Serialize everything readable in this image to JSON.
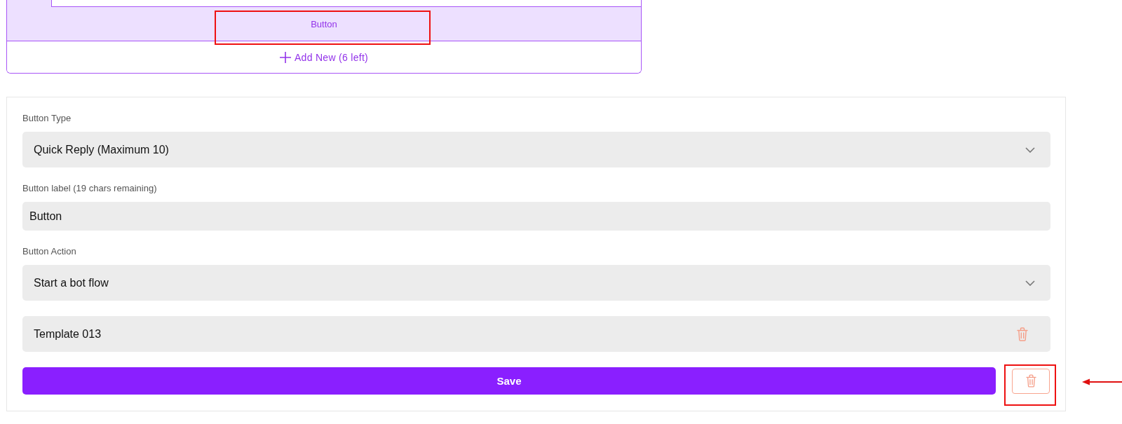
{
  "preview": {
    "button_label": "Button",
    "highlighted": true,
    "add_new": "Add New (6 left)"
  },
  "form": {
    "fields": [
      {
        "kind": "select",
        "label": "Button Type",
        "value": "Quick Reply (Maximum 10)"
      },
      {
        "kind": "input",
        "label": "Button label (19 chars remaining)",
        "value": "Button"
      },
      {
        "kind": "select",
        "label": "Button Action",
        "value": "Start a bot flow"
      },
      {
        "kind": "removable",
        "value": "Template 013"
      }
    ],
    "save": "Save",
    "delete_highlighted": true
  },
  "annotation_arrow": true
}
